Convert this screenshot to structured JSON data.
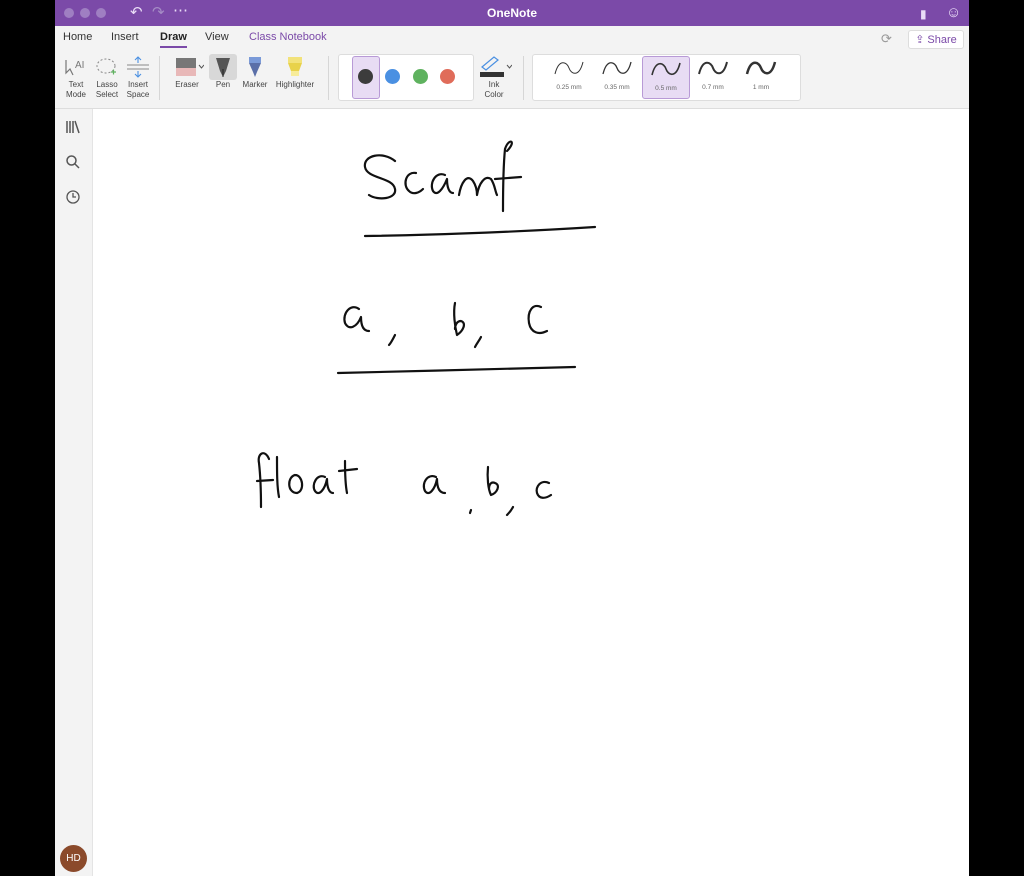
{
  "app": {
    "title": "OneNote"
  },
  "menu": {
    "tabs": [
      "Home",
      "Insert",
      "Draw",
      "View",
      "Class Notebook"
    ],
    "share_label": "Share"
  },
  "ribbon": {
    "tools": {
      "text_mode": [
        "Text",
        "Mode"
      ],
      "lasso_select": [
        "Lasso",
        "Select"
      ],
      "insert_space": [
        "Insert",
        "Space"
      ]
    },
    "pens": {
      "eraser": "Eraser",
      "pen": "Pen",
      "marker": "Marker",
      "highlighter": "Highlighter"
    },
    "colors": [
      "#3c3c3c",
      "#4a90e2",
      "#5fb25f",
      "#e06c5a"
    ],
    "ink_color": [
      "Ink",
      "Color"
    ],
    "widths": [
      "0.25 mm",
      "0.35 mm",
      "0.5 mm",
      "0.7 mm",
      "1 mm"
    ],
    "selected_width": "0.5 mm"
  },
  "user": {
    "initials": "HD"
  },
  "accent_color": "#7b4aa8"
}
